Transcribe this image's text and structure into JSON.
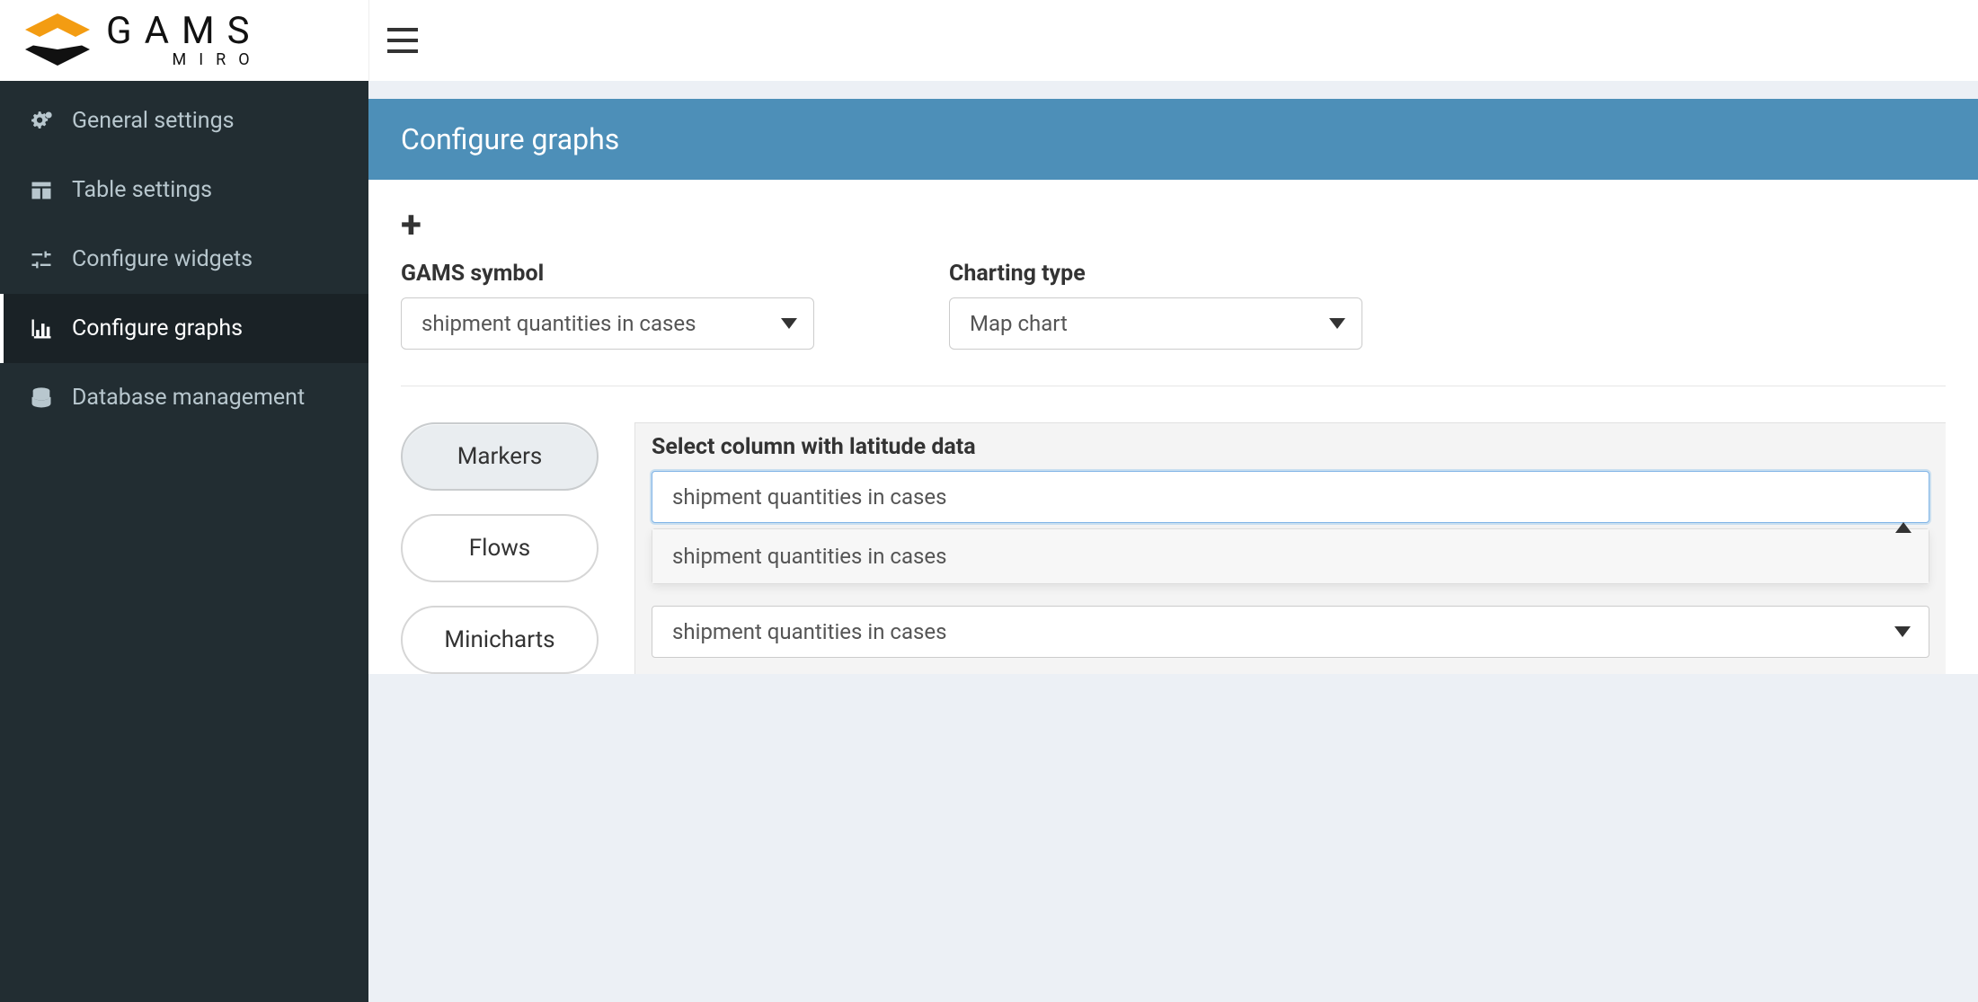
{
  "brand": {
    "name": "GAMS",
    "sub": "MIRO"
  },
  "sidebar": {
    "items": [
      {
        "label": "General settings"
      },
      {
        "label": "Table settings"
      },
      {
        "label": "Configure widgets"
      },
      {
        "label": "Configure graphs"
      },
      {
        "label": "Database management"
      }
    ]
  },
  "panel": {
    "title": "Configure graphs",
    "symbol_label": "GAMS symbol",
    "symbol_value": "shipment quantities in cases",
    "chart_type_label": "Charting type",
    "chart_type_value": "Map chart"
  },
  "tabs": {
    "markers": "Markers",
    "flows": "Flows",
    "minicharts": "Minicharts"
  },
  "latitude": {
    "label": "Select column with latitude data",
    "selected": "shipment quantities in cases",
    "option": "shipment quantities in cases",
    "second_value": "shipment quantities in cases"
  }
}
